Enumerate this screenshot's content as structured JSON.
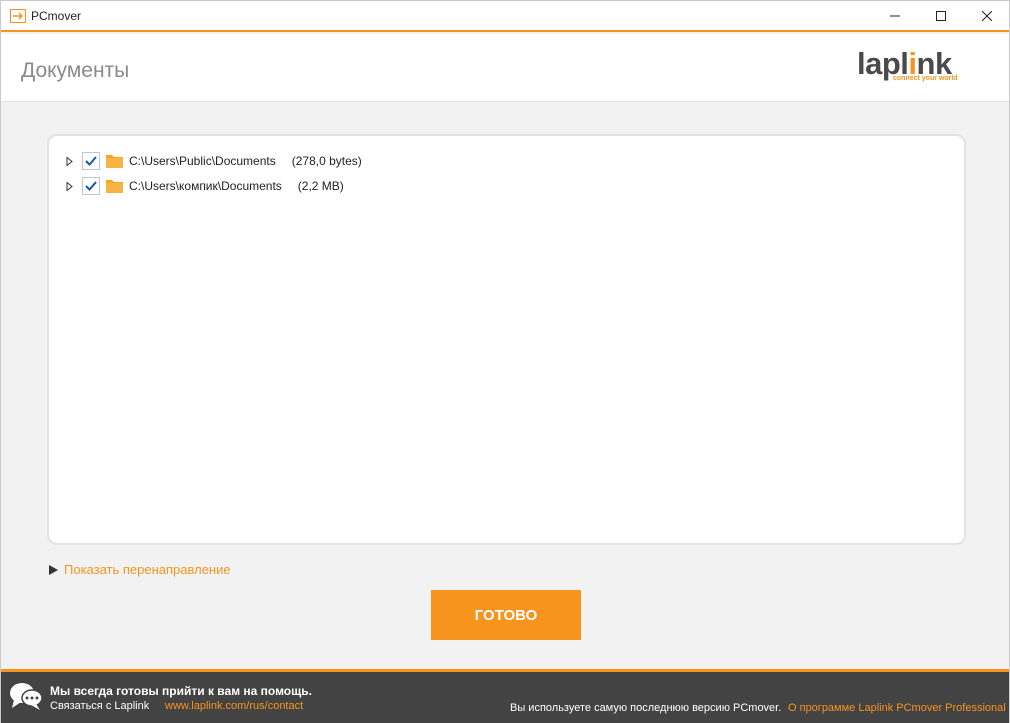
{
  "window": {
    "title": "PCmover"
  },
  "header": {
    "page_title": "Документы",
    "logo_text_pre": "lapl",
    "logo_text_i": "i",
    "logo_text_post": "nk",
    "logo_tagline": "connect your world"
  },
  "tree": {
    "items": [
      {
        "path": "C:\\Users\\Public\\Documents",
        "size": "(278,0 bytes)",
        "checked": true
      },
      {
        "path": "C:\\Users\\компик\\Documents",
        "size": "(2,2 MB)",
        "checked": true
      }
    ]
  },
  "redirect": {
    "label": "Показать перенаправление"
  },
  "actions": {
    "done_label": "ГОТОВО"
  },
  "footer": {
    "help_text": "Мы всегда готовы прийти к вам на помощь.",
    "contact_label": "Связаться с Laplink",
    "contact_link": "www.laplink.com/rus/contact",
    "version_text": "Вы используете самую последнюю версию PCmover.",
    "about_link": "О программе Laplink PCmover Professional"
  },
  "colors": {
    "accent": "#f7941d",
    "footer_bg": "#434343",
    "check": "#1a5a9a"
  }
}
